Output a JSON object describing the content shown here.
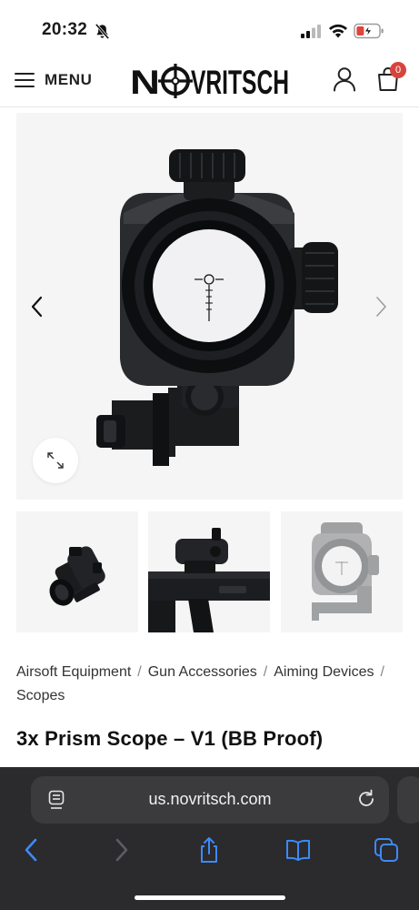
{
  "status_bar": {
    "time": "20:32",
    "icons": [
      "bell-slash-icon",
      "cellular-signal-icon",
      "wifi-icon",
      "battery-charging-icon"
    ],
    "battery_color": "#e0443a"
  },
  "header": {
    "menu_label": "MENU",
    "logo_text": "NOVRITSCH",
    "cart_count": "0",
    "badge_color": "#d6453d"
  },
  "gallery": {
    "main_image": "prism-scope-front-view",
    "thumbnails": [
      "prism-scope-angled-view",
      "prism-scope-mounted-on-rifle",
      "prism-scope-front-view"
    ],
    "controls": [
      "chevron-left-icon",
      "chevron-right-icon",
      "expand-icon"
    ]
  },
  "breadcrumb": {
    "items": [
      "Airsoft Equipment",
      "Gun Accessories",
      "Aiming Devices",
      "Scopes"
    ],
    "separator": "/"
  },
  "product": {
    "title": "3x Prism Scope – V1 (BB Proof)"
  },
  "browser": {
    "url": "us.novritsch.com",
    "accent_color": "#3d8af7",
    "toolbar_icons": [
      "back-icon",
      "forward-icon",
      "share-icon",
      "bookmarks-icon",
      "tabs-icon"
    ]
  }
}
